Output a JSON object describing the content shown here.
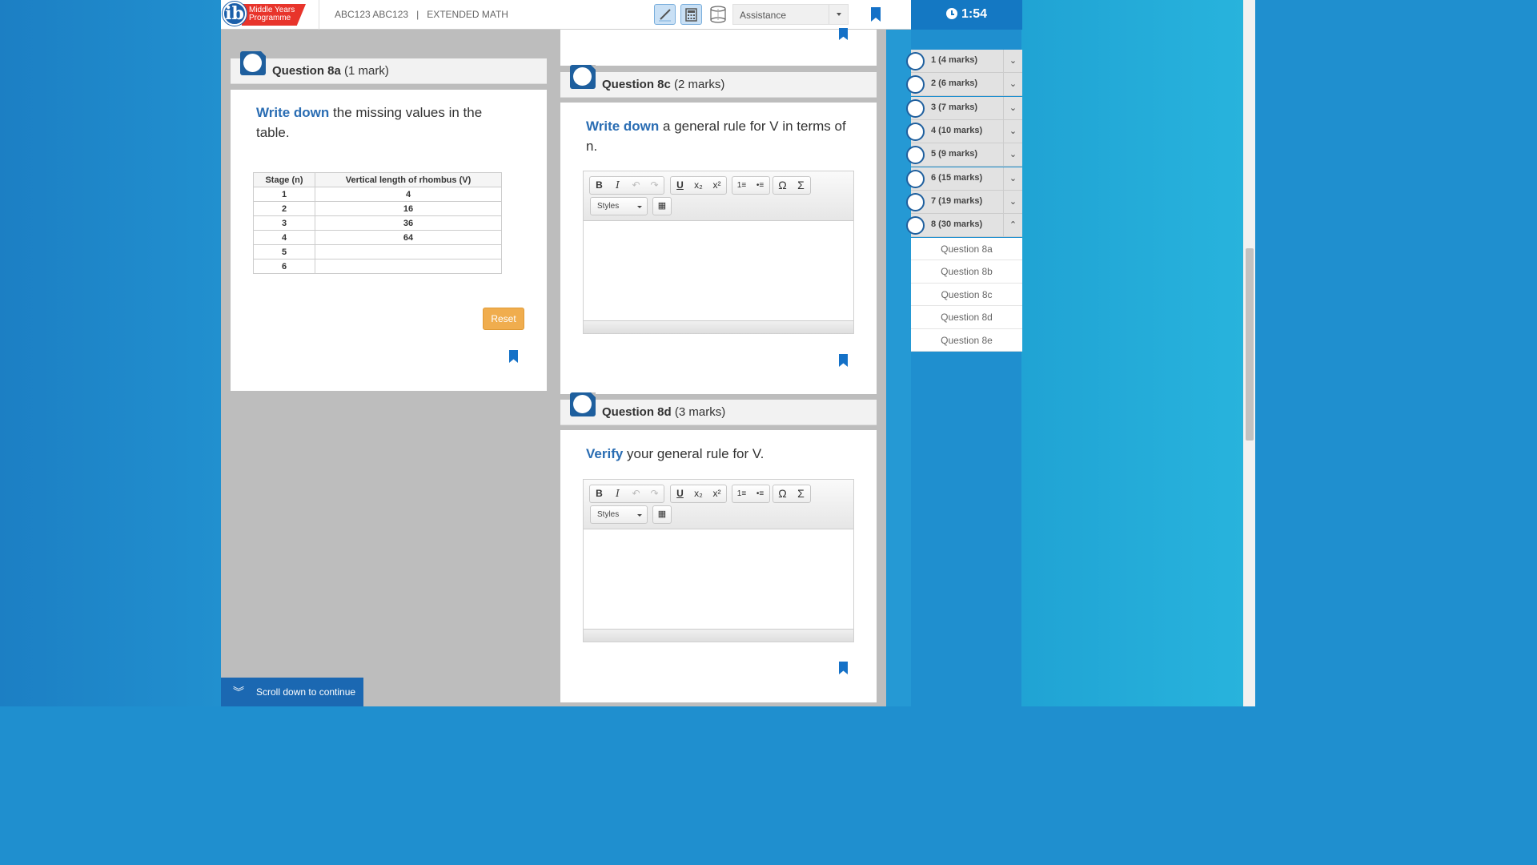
{
  "header": {
    "logo_text_line1": "Middle Years",
    "logo_text_line2": "Programme",
    "logo_letter": "ib",
    "candidate": "ABC123 ABC123",
    "separator": "|",
    "subject": "EXTENDED MATH",
    "assistance_label": "Assistance",
    "timer": "1:54"
  },
  "q8a": {
    "title": "Question 8a",
    "marks": "(1 mark)",
    "prompt_keyword": "Write down",
    "prompt_rest": " the missing values in the table.",
    "table": {
      "headers": [
        "Stage (n)",
        "Vertical length of rhombus (V)"
      ],
      "rows": [
        [
          "1",
          "4"
        ],
        [
          "2",
          "16"
        ],
        [
          "3",
          "36"
        ],
        [
          "4",
          "64"
        ],
        [
          "5",
          ""
        ],
        [
          "6",
          ""
        ]
      ]
    },
    "reset_label": "Reset"
  },
  "q8c": {
    "title": "Question 8c",
    "marks": "(2 marks)",
    "prompt_keyword": "Write down",
    "prompt_rest": " a general rule for V in terms of n."
  },
  "q8d": {
    "title": "Question 8d",
    "marks": "(3 marks)",
    "prompt_keyword": "Verify",
    "prompt_rest": " your general rule for V."
  },
  "editor": {
    "styles_label": "Styles",
    "buttons": [
      "B",
      "I",
      "↶",
      "↷",
      "U",
      "x₂",
      "x²",
      "1≡",
      "•≡",
      "Ω",
      "Σ"
    ]
  },
  "nav": {
    "items": [
      {
        "label": "1 (4 marks)",
        "toggle": "⌄"
      },
      {
        "label": "2 (6 marks)",
        "toggle": "⌄"
      },
      {
        "label": "3 (7 marks)",
        "toggle": "⌄"
      },
      {
        "label": "4 (10 marks)",
        "toggle": "⌄"
      },
      {
        "label": "5 (9 marks)",
        "toggle": "⌄"
      },
      {
        "label": "6 (15 marks)",
        "toggle": "⌄"
      },
      {
        "label": "7 (19 marks)",
        "toggle": "⌄"
      },
      {
        "label": "8 (30 marks)",
        "toggle": "⌃"
      }
    ],
    "subitems": [
      "Question 8a",
      "Question 8b",
      "Question 8c",
      "Question 8d",
      "Question 8e"
    ]
  },
  "footer": {
    "scroll_label": "Scroll down to continue"
  },
  "colors": {
    "accent": "#2a6db3",
    "timer_bg": "#1478c3",
    "reset": "#f0ad4e",
    "bookmark": "#1471c7"
  }
}
